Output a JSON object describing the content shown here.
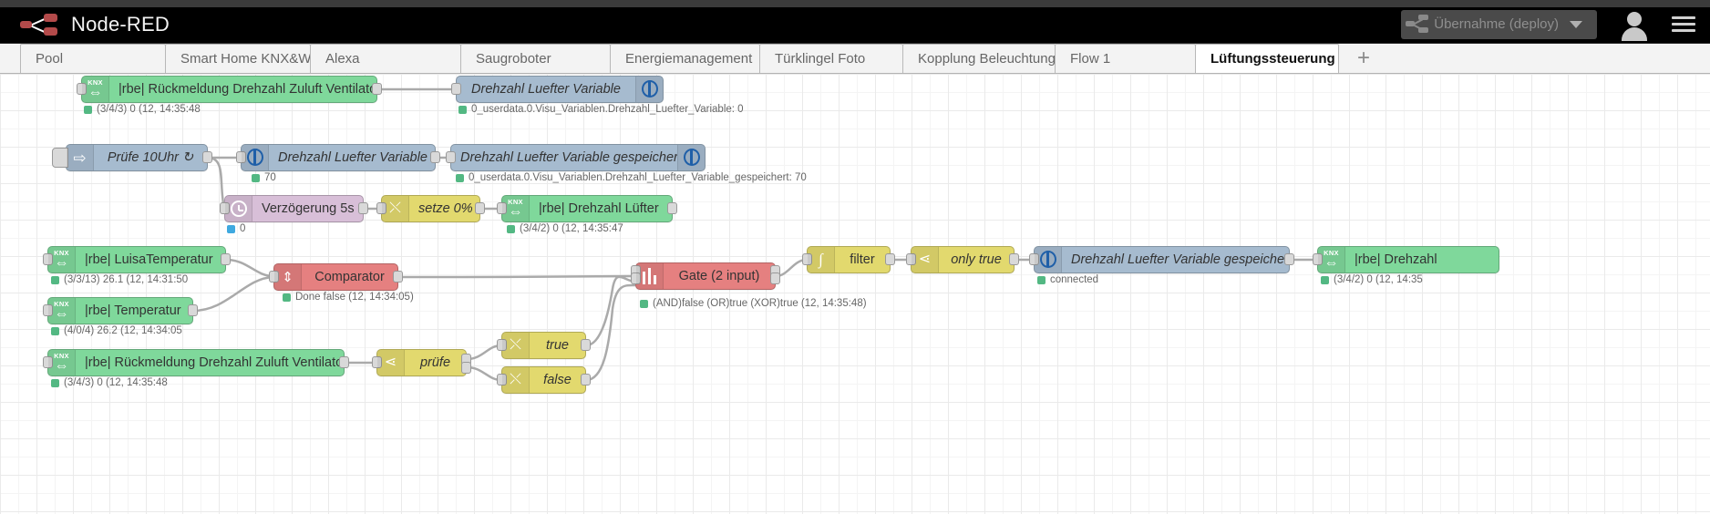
{
  "header": {
    "brand": "Node-RED",
    "deploy_label": "Übernahme (deploy)",
    "deploy_icon": "deploy-icon",
    "user_icon": "user-icon",
    "menu_icon": "hamburger-menu-icon",
    "caret_icon": "chevron-down-icon"
  },
  "tabs": {
    "add_label": "+",
    "items": [
      {
        "label": "Pool",
        "active": false
      },
      {
        "label": "Smart Home KNX&WIFI",
        "active": false
      },
      {
        "label": "Alexa",
        "active": false
      },
      {
        "label": "Saugroboter",
        "active": false
      },
      {
        "label": "Energiemanagement",
        "active": false
      },
      {
        "label": "Türklingel Foto",
        "active": false
      },
      {
        "label": "Kopplung Beleuchtung",
        "active": false
      },
      {
        "label": "Flow 1",
        "active": false
      },
      {
        "label": "Lüftungssteuerung",
        "active": true
      }
    ]
  },
  "colors": {
    "knx_green": "#7fd89b",
    "object_blue": "#a6bbcf",
    "function_yellow": "#e2d96e",
    "delay_purple": "#d8bfd8",
    "gate_red": "#e58080",
    "status_green": "#53b883",
    "status_blue": "#3fa9e0"
  },
  "nodes": [
    {
      "id": "n1",
      "label": "|rbe| Rückmeldung Drehzahl Zuluft Ventilator",
      "type": "knx",
      "icon": "knx-icon",
      "status": "(3/4/3) 0 (12, 14:35:48",
      "status_dot": "green"
    },
    {
      "id": "n2",
      "label": "Drehzahl Luefter Variable",
      "type": "object",
      "icon": "iobroker-icon",
      "status": "0_userdata.0.Visu_Variablen.Drehzahl_Luefter_Variable: 0",
      "status_dot": "green"
    },
    {
      "id": "n3",
      "label": "Prüfe 10Uhr ↻",
      "type": "inject",
      "icon": "inject-arrow-icon",
      "status": "",
      "status_dot": ""
    },
    {
      "id": "n4",
      "label": "Drehzahl Luefter Variable",
      "type": "object",
      "icon": "iobroker-icon",
      "status": "70",
      "status_dot": "green"
    },
    {
      "id": "n5",
      "label": "Drehzahl Luefter Variable gespeichert",
      "type": "object",
      "icon": "iobroker-icon",
      "status": "0_userdata.0.Visu_Variablen.Drehzahl_Luefter_Variable_gespeichert: 70",
      "status_dot": "green"
    },
    {
      "id": "n6",
      "label": "Verzögerung 5s",
      "type": "delay",
      "icon": "clock-icon",
      "status": "0",
      "status_dot": "blue"
    },
    {
      "id": "n7",
      "label": "setze 0%",
      "type": "change",
      "icon": "switch-icon",
      "status": "",
      "status_dot": ""
    },
    {
      "id": "n8",
      "label": "|rbe| Drehzahl Lüfter",
      "type": "knx",
      "icon": "knx-icon",
      "status": "(3/4/2) 0 (12, 14:35:47",
      "status_dot": "green"
    },
    {
      "id": "n9",
      "label": "|rbe| LuisaTemperatur",
      "type": "knx",
      "icon": "knx-icon",
      "status": "(3/3/13) 26.1 (12, 14:31:50",
      "status_dot": "green"
    },
    {
      "id": "n10",
      "label": "Comparator",
      "type": "comparator",
      "icon": "comparator-icon",
      "status": "Done false (12, 14:34:05)",
      "status_dot": "green"
    },
    {
      "id": "n11",
      "label": "|rbe| Temperatur",
      "type": "knx",
      "icon": "knx-icon",
      "status": "(4/0/4) 26.2 (12, 14:34:05",
      "status_dot": "green"
    },
    {
      "id": "n12",
      "label": "|rbe| Rückmeldung Drehzahl Zuluft Ventilator",
      "type": "knx",
      "icon": "knx-icon",
      "status": "(3/4/3) 0 (12, 14:35:48",
      "status_dot": "green"
    },
    {
      "id": "n13",
      "label": "prüfe",
      "type": "switch",
      "icon": "switch-icon",
      "status": "",
      "status_dot": ""
    },
    {
      "id": "n14",
      "label": "true",
      "type": "change",
      "icon": "change-icon",
      "status": "",
      "status_dot": ""
    },
    {
      "id": "n15",
      "label": "false",
      "type": "change",
      "icon": "change-icon",
      "status": "",
      "status_dot": ""
    },
    {
      "id": "n16",
      "label": "Gate (2 input)",
      "type": "gate",
      "icon": "gate-icon",
      "status": "(AND)false (OR)true (XOR)true (12, 14:35:48)",
      "status_dot": "green"
    },
    {
      "id": "n17",
      "label": "filter",
      "type": "filter",
      "icon": "filter-icon",
      "status": "",
      "status_dot": ""
    },
    {
      "id": "n18",
      "label": "only true",
      "type": "switch",
      "icon": "switch-icon",
      "status": "",
      "status_dot": ""
    },
    {
      "id": "n19",
      "label": "Drehzahl Luefter Variable gespeichert",
      "type": "object",
      "icon": "iobroker-icon",
      "status": "connected",
      "status_dot": "green"
    },
    {
      "id": "n20",
      "label": "|rbe| Drehzahl",
      "type": "knx",
      "icon": "knx-icon",
      "status": "(3/4/2) 0 (12, 14:35",
      "status_dot": "green"
    }
  ]
}
